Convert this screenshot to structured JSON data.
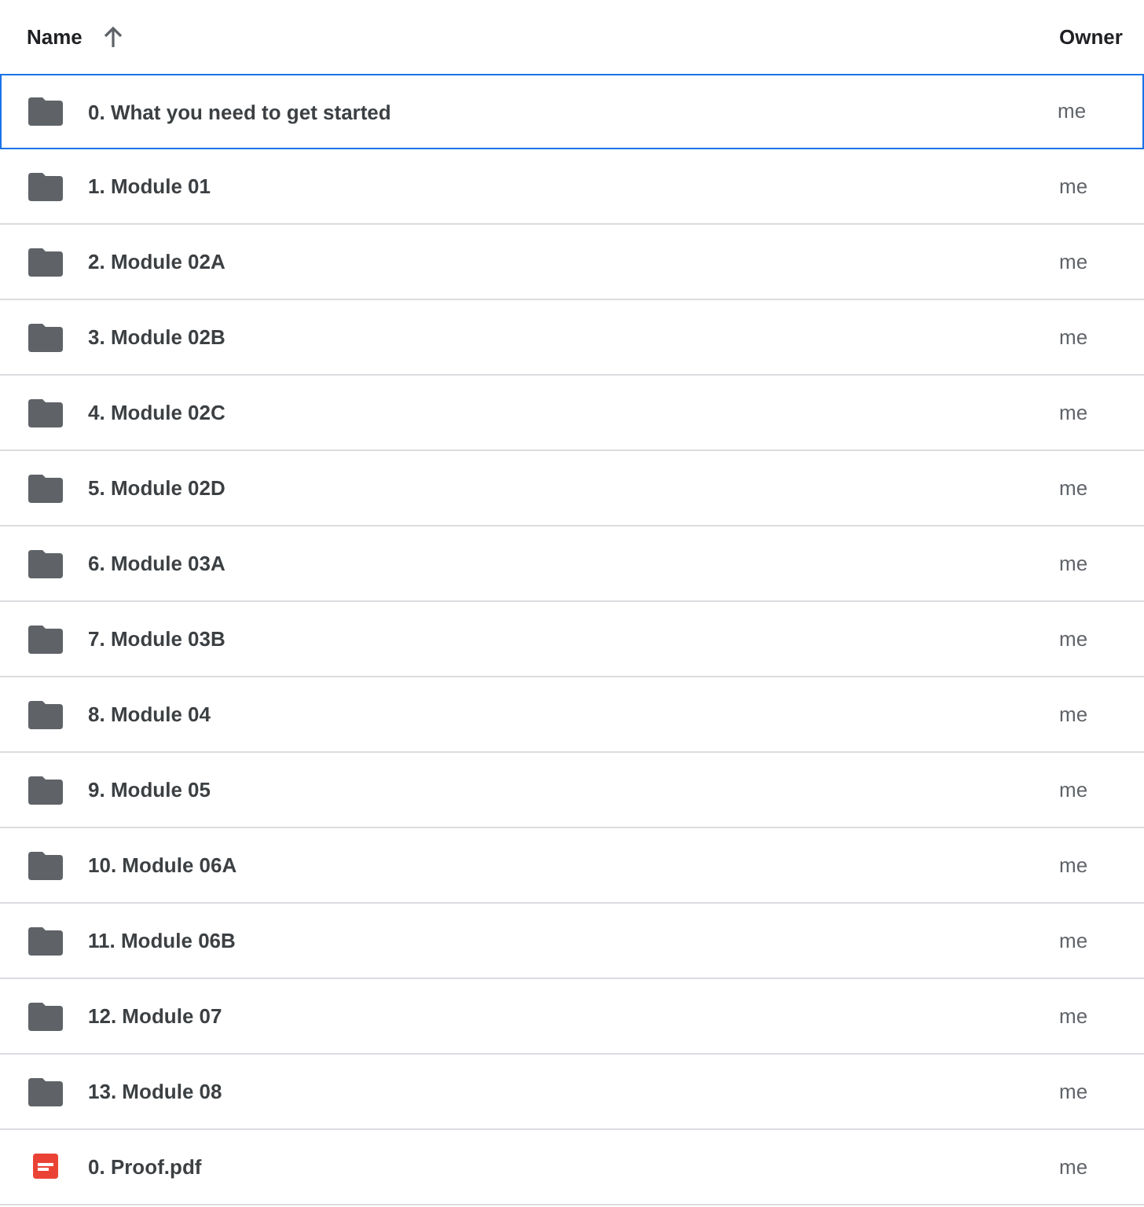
{
  "table": {
    "columns": [
      {
        "label": "Name",
        "sorted_ascending": true
      },
      {
        "label": "Owner"
      }
    ],
    "rows": [
      {
        "kind": "folder",
        "name": "0. What you need to get started",
        "owner": "me",
        "selected": true
      },
      {
        "kind": "folder",
        "name": "1. Module 01",
        "owner": "me",
        "selected": false
      },
      {
        "kind": "folder",
        "name": "2. Module 02A",
        "owner": "me",
        "selected": false
      },
      {
        "kind": "folder",
        "name": "3. Module 02B",
        "owner": "me",
        "selected": false
      },
      {
        "kind": "folder",
        "name": "4. Module 02C",
        "owner": "me",
        "selected": false
      },
      {
        "kind": "folder",
        "name": "5. Module 02D",
        "owner": "me",
        "selected": false
      },
      {
        "kind": "folder",
        "name": "6. Module 03A",
        "owner": "me",
        "selected": false
      },
      {
        "kind": "folder",
        "name": "7. Module 03B",
        "owner": "me",
        "selected": false
      },
      {
        "kind": "folder",
        "name": "8. Module 04",
        "owner": "me",
        "selected": false
      },
      {
        "kind": "folder",
        "name": "9. Module 05",
        "owner": "me",
        "selected": false
      },
      {
        "kind": "folder",
        "name": "10. Module 06A",
        "owner": "me",
        "selected": false
      },
      {
        "kind": "folder",
        "name": "11. Module 06B",
        "owner": "me",
        "selected": false
      },
      {
        "kind": "folder",
        "name": "12. Module 07",
        "owner": "me",
        "selected": false
      },
      {
        "kind": "folder",
        "name": "13. Module 08",
        "owner": "me",
        "selected": false
      },
      {
        "kind": "pdf",
        "name": "0. Proof.pdf",
        "owner": "me",
        "selected": false
      }
    ]
  }
}
